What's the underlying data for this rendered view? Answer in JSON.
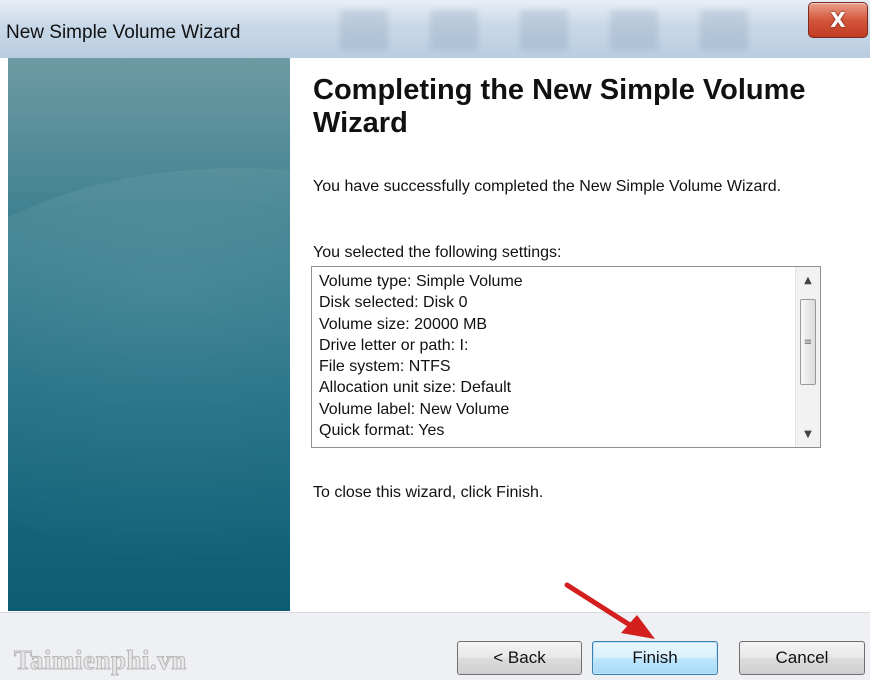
{
  "window": {
    "title": "New Simple Volume Wizard",
    "close_symbol": "X"
  },
  "main": {
    "heading": "Completing the New Simple Volume Wizard",
    "intro": "You have successfully completed the New Simple Volume Wizard.",
    "settings_label": "You selected the following settings:",
    "settings": [
      "Volume type: Simple Volume",
      "Disk selected: Disk 0",
      "Volume size: 20000 MB",
      "Drive letter or path: I:",
      "File system: NTFS",
      "Allocation unit size: Default",
      "Volume label: New Volume",
      "Quick format: Yes"
    ],
    "close_hint": "To close this wizard, click Finish."
  },
  "buttons": {
    "back": "< Back",
    "finish": "Finish",
    "cancel": "Cancel"
  },
  "watermark": "Taimienphi.vn",
  "icons": {
    "close": "close-icon",
    "scroll_up": "scroll-up-arrow-icon",
    "scroll_down": "scroll-down-arrow-icon",
    "annotation_arrow": "red-arrow-icon"
  },
  "colors": {
    "banner": "#1f6f83",
    "finish_border": "#3c7fb1",
    "annotation": "#d41f1f",
    "close_button": "#c23b23"
  }
}
